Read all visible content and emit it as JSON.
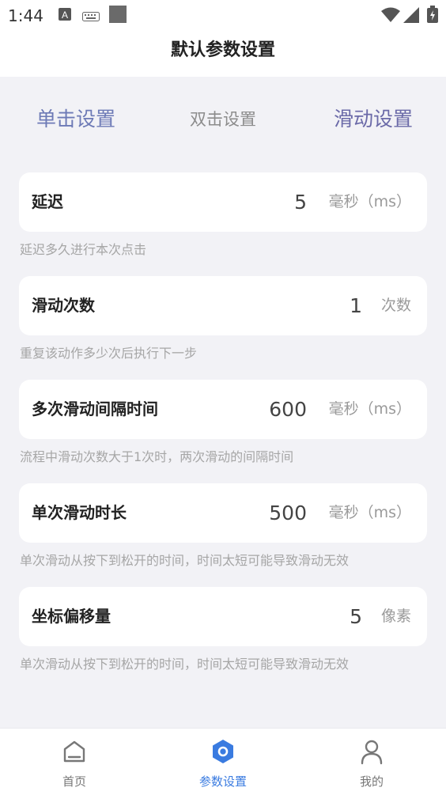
{
  "status_bar": {
    "time": "1:44"
  },
  "header": {
    "title": "默认参数设置"
  },
  "tabs": [
    {
      "label": "单击设置"
    },
    {
      "label": "双击设置"
    },
    {
      "label": "滑动设置"
    }
  ],
  "settings": [
    {
      "label": "延迟",
      "value": "5",
      "unit": "毫秒（ms）",
      "description": "延迟多久进行本次点击"
    },
    {
      "label": "滑动次数",
      "value": "1",
      "unit": "次数",
      "description": "重复该动作多少次后执行下一步"
    },
    {
      "label": "多次滑动间隔时间",
      "value": "600",
      "unit": "毫秒（ms）",
      "description": "流程中滑动次数大于1次时，两次滑动的间隔时间"
    },
    {
      "label": "单次滑动时长",
      "value": "500",
      "unit": "毫秒（ms）",
      "description": "单次滑动从按下到松开的时间，时间太短可能导致滑动无效"
    },
    {
      "label": "坐标偏移量",
      "value": "5",
      "unit": "像素",
      "description": "单次滑动从按下到松开的时间，时间太短可能导致滑动无效"
    }
  ],
  "bottom_nav": [
    {
      "label": "首页",
      "icon": "home-icon"
    },
    {
      "label": "参数设置",
      "icon": "settings-hex-icon",
      "active": true
    },
    {
      "label": "我的",
      "icon": "person-icon"
    }
  ],
  "colors": {
    "accent": "#3a7be0",
    "tab_active": "#6b6aa8",
    "background": "#f2f2f6"
  }
}
